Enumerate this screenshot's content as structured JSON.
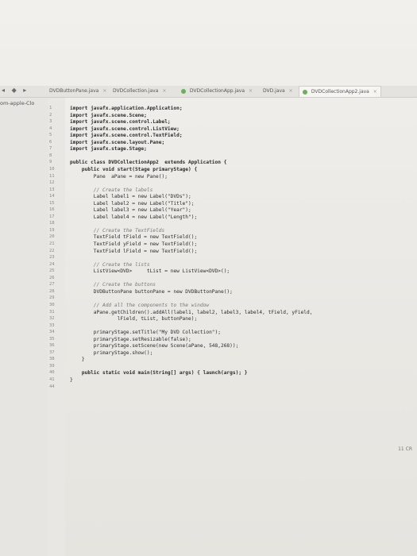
{
  "sidebar": {
    "project_label": "om-apple-Clo"
  },
  "tabs": [
    {
      "label": "DVDButtonPane.java",
      "active": false
    },
    {
      "label": "DVDCollection.java",
      "active": false
    },
    {
      "label": "DVDCollectionApp.java",
      "active": false
    },
    {
      "label": "DVD.java",
      "active": false
    },
    {
      "label": "DVDCollectionApp2.java",
      "active": true
    }
  ],
  "gutter_numbers": [
    "1",
    "2",
    "3",
    "4",
    "5",
    "6",
    "7",
    "8",
    "9",
    "10",
    "11",
    "12",
    "13",
    "14",
    "15",
    "16",
    "17",
    "18",
    "19",
    "20",
    "21",
    "22",
    "23",
    "24",
    "25",
    "26",
    "27",
    "28",
    "29",
    "30",
    "31",
    "32",
    "33",
    "34",
    "35",
    "36",
    "37",
    "38",
    "39",
    "40",
    "41",
    "44"
  ],
  "code_lines": [
    "import javafx.application.Application;",
    "import javafx.scene.Scene;",
    "import javafx.scene.control.Label;",
    "import javafx.scene.control.ListView;",
    "import javafx.scene.control.TextField;",
    "import javafx.scene.layout.Pane;",
    "import javafx.stage.Stage;",
    "",
    "public class DVDCollectionApp2  extends Application {",
    "    public void start(Stage primaryStage) {",
    "        Pane  aPane = new Pane();",
    "",
    "        // Create the labels",
    "        Label label1 = new Label(\"DVDs\");",
    "        Label label2 = new Label(\"Title\");",
    "        Label label3 = new Label(\"Year\");",
    "        Label label4 = new Label(\"Length\");",
    "",
    "        // Create the TextFields",
    "        TextField tField = new TextField();",
    "        TextField yField = new TextField();",
    "        TextField lField = new TextField();",
    "",
    "        // Create the lists",
    "        ListView<DVD>     tList = new ListView<DVD>();",
    "",
    "        // Create the buttons",
    "        DVDButtonPane buttonPane = new DVDButtonPane();",
    "",
    "        // Add all the components to the window",
    "        aPane.getChildren().addAll(label1, label2, label3, label4, tField, yField,",
    "                lField, tList, buttonPane);",
    "",
    "        primaryStage.setTitle(\"My DVD Collection\");",
    "        primaryStage.setResizable(false);",
    "        primaryStage.setScene(new Scene(aPane, 548,268));",
    "        primaryStage.show();",
    "    }",
    "",
    "    public static void main(String[] args) { launch(args); }",
    "}",
    ""
  ],
  "status": {
    "text": "11  CR"
  },
  "colors": {
    "accent": "#6cae5e"
  }
}
